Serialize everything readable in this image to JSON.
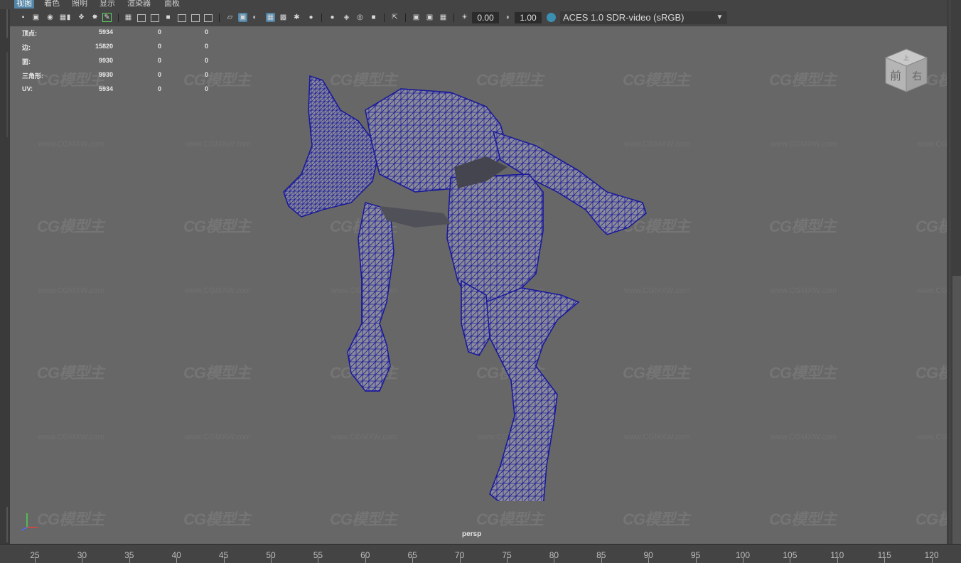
{
  "menu": {
    "items": [
      "视图",
      "着色",
      "照明",
      "显示",
      "渲染器",
      "面板"
    ],
    "active_index": 0
  },
  "toolbar": {
    "exposure_value": "0.00",
    "gamma_value": "1.00",
    "color_space": "ACES 1.0 SDR-video (sRGB)"
  },
  "hud": {
    "rows": [
      {
        "label": "顶点:",
        "values": [
          "5934",
          "0",
          "0"
        ]
      },
      {
        "label": "边:",
        "values": [
          "15820",
          "0",
          "0"
        ]
      },
      {
        "label": "面:",
        "values": [
          "9930",
          "0",
          "0"
        ]
      },
      {
        "label": "三角形:",
        "values": [
          "9930",
          "0",
          "0"
        ]
      },
      {
        "label": "UV:",
        "values": [
          "5934",
          "0",
          "0"
        ]
      }
    ]
  },
  "viewcube": {
    "top": "上",
    "front": "前",
    "right": "右"
  },
  "camera": {
    "name": "persp"
  },
  "watermark": {
    "logo": "CG模型主",
    "url": "www.CGMXW.com"
  },
  "timeline": {
    "ticks": [
      "25",
      "30",
      "35",
      "40",
      "45",
      "50",
      "55",
      "60",
      "65",
      "70",
      "75",
      "80",
      "85",
      "90",
      "95",
      "100",
      "105",
      "110",
      "115",
      "120"
    ]
  },
  "colors": {
    "viewport_bg": "#676767",
    "wireframe": "#1a1a9c",
    "mesh_fill": "#8a8a95",
    "active_menu": "#5285a6"
  }
}
